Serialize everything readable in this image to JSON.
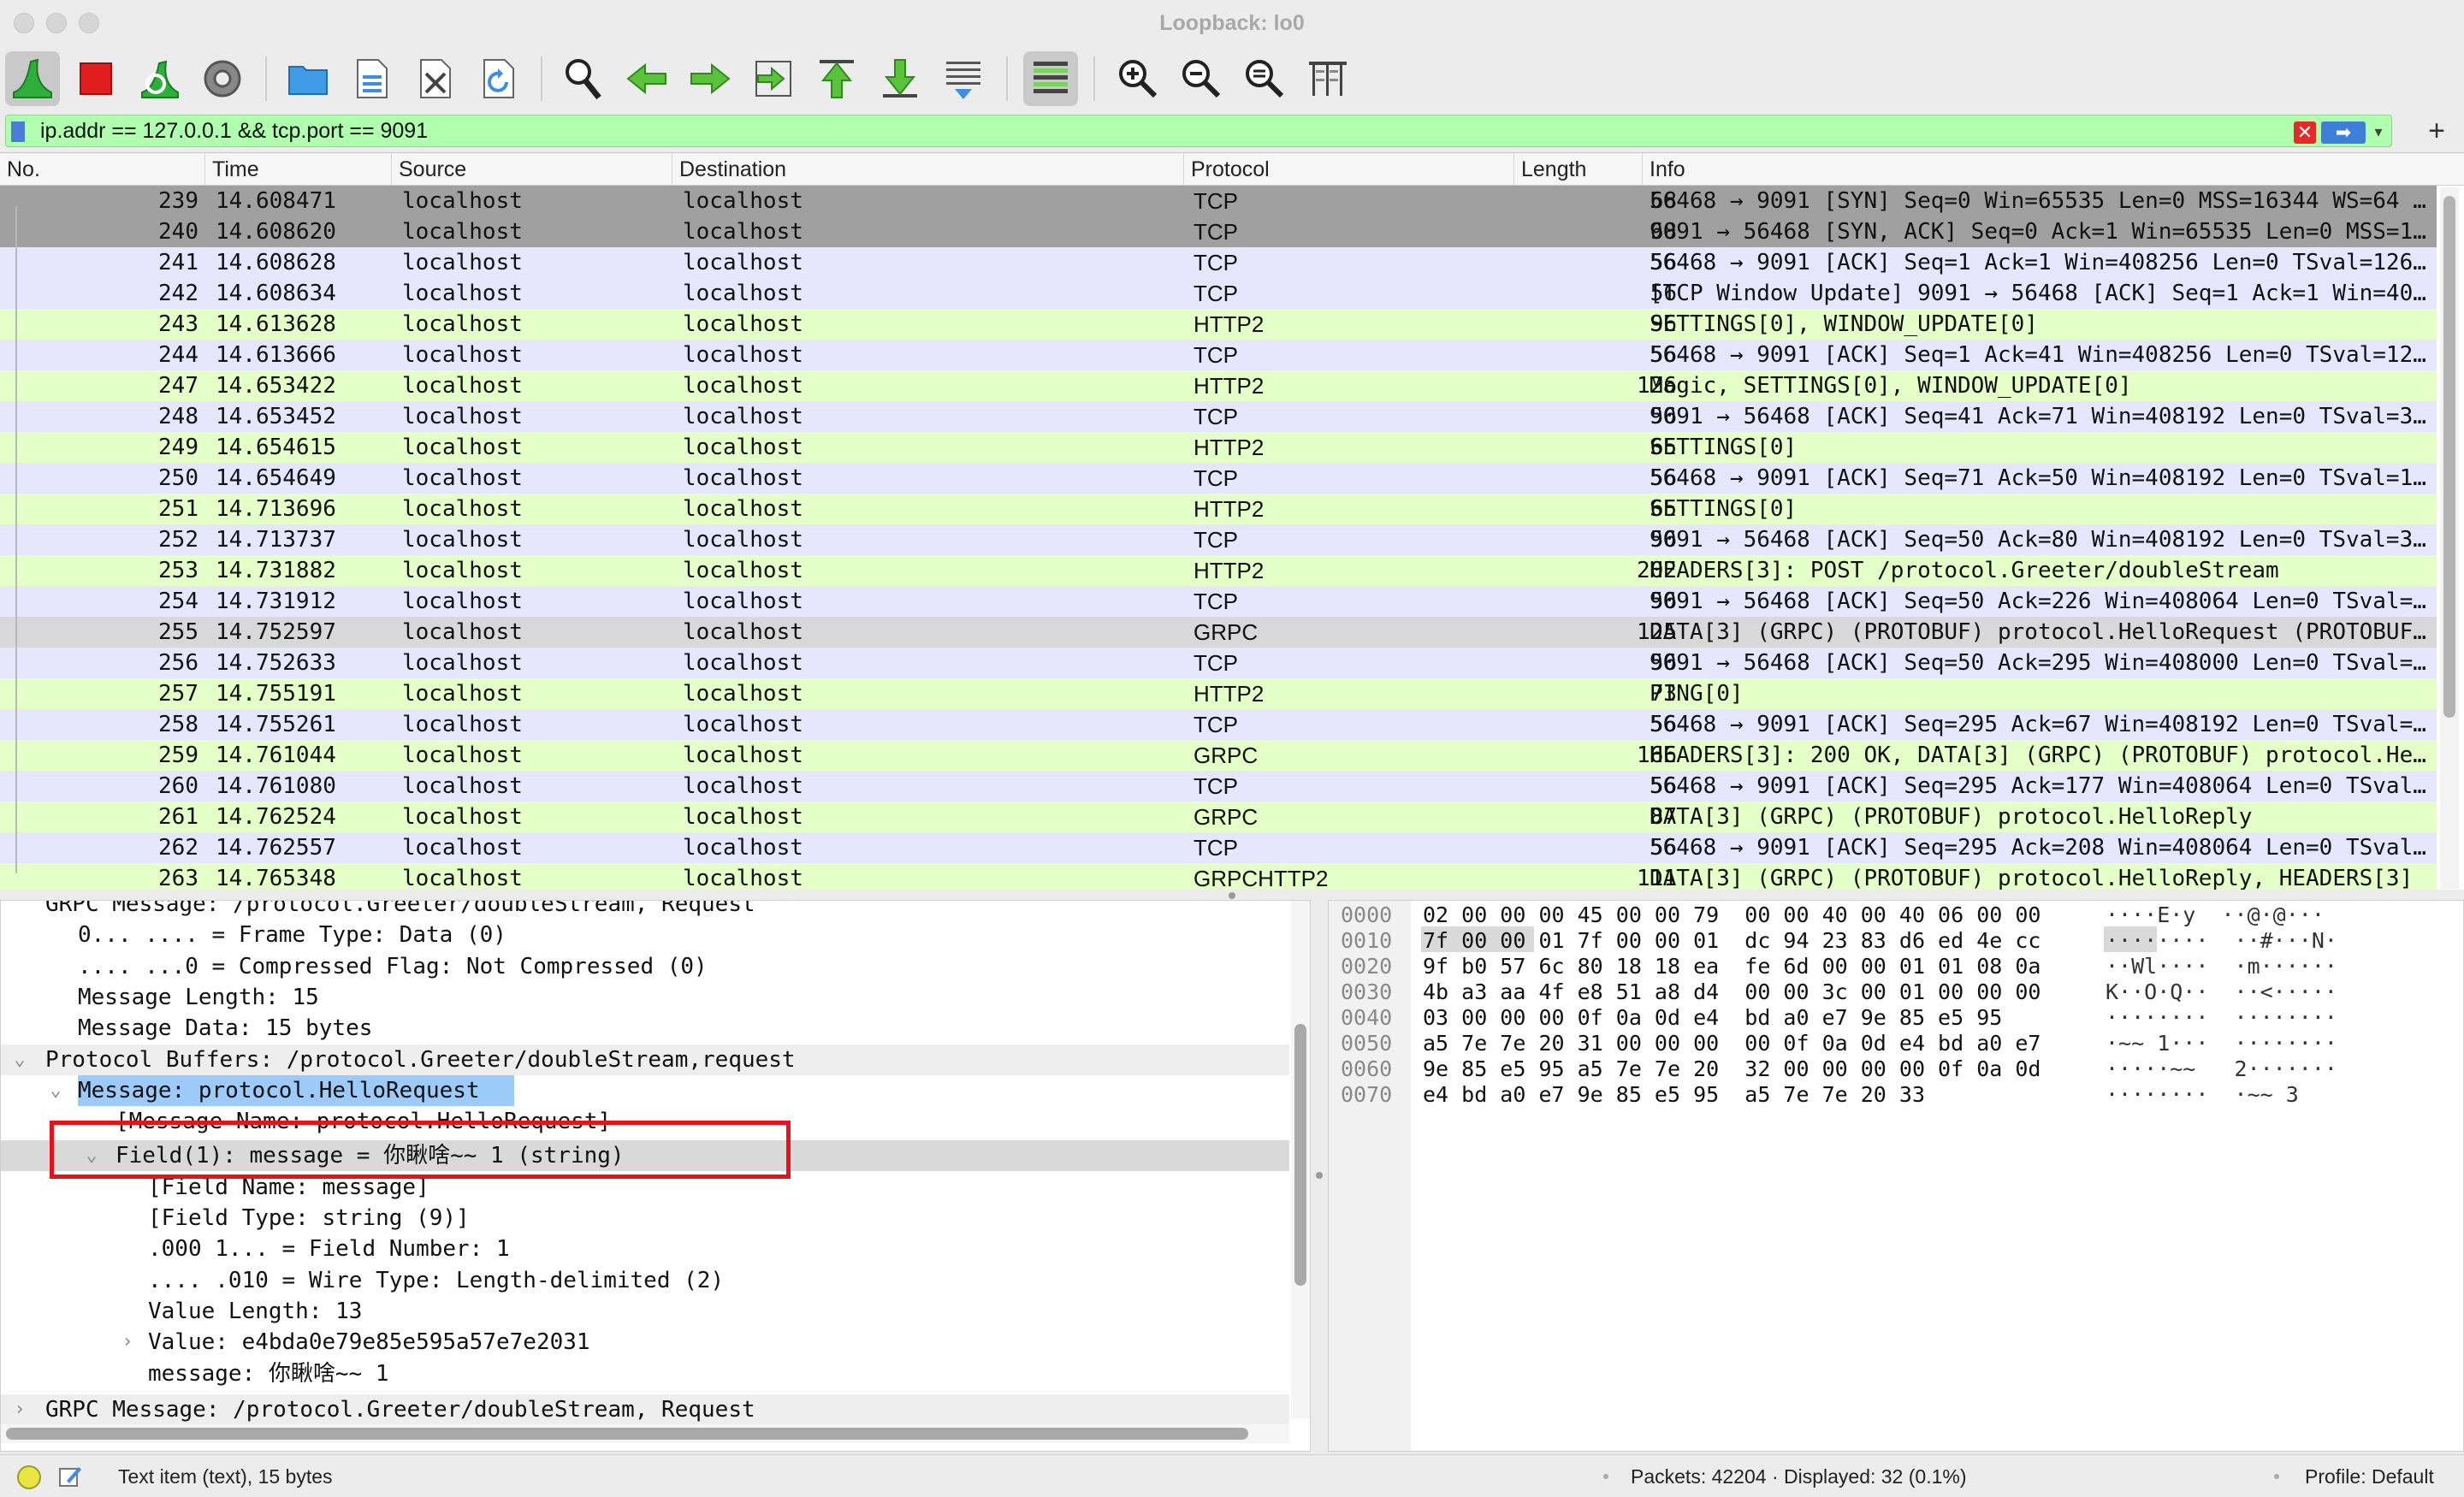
{
  "window": {
    "title": "Loopback: lo0"
  },
  "toolbar": {
    "buttons": [
      "start-capture-icon",
      "stop-capture-icon",
      "restart-capture-icon",
      "capture-options-icon",
      "open-file-icon",
      "save-file-icon",
      "close-file-icon",
      "reload-file-icon",
      "find-packet-icon",
      "go-back-icon",
      "go-forward-icon",
      "go-to-packet-icon",
      "first-packet-icon",
      "last-packet-icon",
      "autoscroll-icon",
      "colorize-icon",
      "zoom-in-icon",
      "zoom-out-icon",
      "normal-size-icon",
      "resize-columns-icon"
    ]
  },
  "filter": {
    "value": "ip.addr == 127.0.0.1  && tcp.port == 9091",
    "background": "#afffaf"
  },
  "packet_list": {
    "columns": [
      "No.",
      "Time",
      "Source",
      "Destination",
      "Protocol",
      "Length",
      "Info"
    ],
    "colors": {
      "tcp": "#e7e6ff",
      "http2": "#e4ffc7",
      "selected": "#a0a0a0",
      "related": "#d8d8d8"
    },
    "rows": [
      {
        "no": "239",
        "time": "14.608471",
        "src": "localhost",
        "dst": "localhost",
        "proto": "TCP",
        "len": "68",
        "info": "56468 → 9091 [SYN] Seq=0 Win=65535 Len=0 MSS=16344 WS=64 …",
        "style": "selected"
      },
      {
        "no": "240",
        "time": "14.608620",
        "src": "localhost",
        "dst": "localhost",
        "proto": "TCP",
        "len": "68",
        "info": "9091 → 56468 [SYN, ACK] Seq=0 Ack=1 Win=65535 Len=0 MSS=1…",
        "style": "selected"
      },
      {
        "no": "241",
        "time": "14.608628",
        "src": "localhost",
        "dst": "localhost",
        "proto": "TCP",
        "len": "56",
        "info": "56468 → 9091 [ACK] Seq=1 Ack=1 Win=408256 Len=0 TSval=126…",
        "style": "tcp"
      },
      {
        "no": "242",
        "time": "14.608634",
        "src": "localhost",
        "dst": "localhost",
        "proto": "TCP",
        "len": "56",
        "info": "[TCP Window Update] 9091 → 56468 [ACK] Seq=1 Ack=1 Win=40…",
        "style": "tcp"
      },
      {
        "no": "243",
        "time": "14.613628",
        "src": "localhost",
        "dst": "localhost",
        "proto": "HTTP2",
        "len": "96",
        "info": "SETTINGS[0], WINDOW_UPDATE[0]",
        "style": "http2"
      },
      {
        "no": "244",
        "time": "14.613666",
        "src": "localhost",
        "dst": "localhost",
        "proto": "TCP",
        "len": "56",
        "info": "56468 → 9091 [ACK] Seq=1 Ack=41 Win=408256 Len=0 TSval=12…",
        "style": "tcp"
      },
      {
        "no": "247",
        "time": "14.653422",
        "src": "localhost",
        "dst": "localhost",
        "proto": "HTTP2",
        "len": "126",
        "info": "Magic, SETTINGS[0], WINDOW_UPDATE[0]",
        "style": "http2"
      },
      {
        "no": "248",
        "time": "14.653452",
        "src": "localhost",
        "dst": "localhost",
        "proto": "TCP",
        "len": "56",
        "info": "9091 → 56468 [ACK] Seq=41 Ack=71 Win=408192 Len=0 TSval=3…",
        "style": "tcp"
      },
      {
        "no": "249",
        "time": "14.654615",
        "src": "localhost",
        "dst": "localhost",
        "proto": "HTTP2",
        "len": "65",
        "info": "SETTINGS[0]",
        "style": "http2"
      },
      {
        "no": "250",
        "time": "14.654649",
        "src": "localhost",
        "dst": "localhost",
        "proto": "TCP",
        "len": "56",
        "info": "56468 → 9091 [ACK] Seq=71 Ack=50 Win=408192 Len=0 TSval=1…",
        "style": "tcp"
      },
      {
        "no": "251",
        "time": "14.713696",
        "src": "localhost",
        "dst": "localhost",
        "proto": "HTTP2",
        "len": "65",
        "info": "SETTINGS[0]",
        "style": "http2"
      },
      {
        "no": "252",
        "time": "14.713737",
        "src": "localhost",
        "dst": "localhost",
        "proto": "TCP",
        "len": "56",
        "info": "9091 → 56468 [ACK] Seq=50 Ack=80 Win=408192 Len=0 TSval=3…",
        "style": "tcp"
      },
      {
        "no": "253",
        "time": "14.731882",
        "src": "localhost",
        "dst": "localhost",
        "proto": "HTTP2",
        "len": "202",
        "info": "HEADERS[3]: POST /protocol.Greeter/doubleStream",
        "style": "http2"
      },
      {
        "no": "254",
        "time": "14.731912",
        "src": "localhost",
        "dst": "localhost",
        "proto": "TCP",
        "len": "56",
        "info": "9091 → 56468 [ACK] Seq=50 Ack=226 Win=408064 Len=0 TSval=…",
        "style": "tcp"
      },
      {
        "no": "255",
        "time": "14.752597",
        "src": "localhost",
        "dst": "localhost",
        "proto": "GRPC",
        "len": "125",
        "info": "DATA[3] (GRPC) (PROTOBUF) protocol.HelloRequest (PROTOBUF…",
        "style": "related"
      },
      {
        "no": "256",
        "time": "14.752633",
        "src": "localhost",
        "dst": "localhost",
        "proto": "TCP",
        "len": "56",
        "info": "9091 → 56468 [ACK] Seq=50 Ack=295 Win=408000 Len=0 TSval=…",
        "style": "tcp"
      },
      {
        "no": "257",
        "time": "14.755191",
        "src": "localhost",
        "dst": "localhost",
        "proto": "HTTP2",
        "len": "73",
        "info": "PING[0]",
        "style": "http2"
      },
      {
        "no": "258",
        "time": "14.755261",
        "src": "localhost",
        "dst": "localhost",
        "proto": "TCP",
        "len": "56",
        "info": "56468 → 9091 [ACK] Seq=295 Ack=67 Win=408192 Len=0 TSval=…",
        "style": "tcp"
      },
      {
        "no": "259",
        "time": "14.761044",
        "src": "localhost",
        "dst": "localhost",
        "proto": "GRPC",
        "len": "166",
        "info": "HEADERS[3]: 200 OK, DATA[3] (GRPC) (PROTOBUF) protocol.He…",
        "style": "http2"
      },
      {
        "no": "260",
        "time": "14.761080",
        "src": "localhost",
        "dst": "localhost",
        "proto": "TCP",
        "len": "56",
        "info": "56468 → 9091 [ACK] Seq=295 Ack=177 Win=408064 Len=0 TSval…",
        "style": "tcp"
      },
      {
        "no": "261",
        "time": "14.762524",
        "src": "localhost",
        "dst": "localhost",
        "proto": "GRPC",
        "len": "87",
        "info": "DATA[3] (GRPC) (PROTOBUF) protocol.HelloReply",
        "style": "http2"
      },
      {
        "no": "262",
        "time": "14.762557",
        "src": "localhost",
        "dst": "localhost",
        "proto": "TCP",
        "len": "56",
        "info": "56468 → 9091 [ACK] Seq=295 Ack=208 Win=408064 Len=0 TSval…",
        "style": "tcp"
      },
      {
        "no": "263",
        "time": "14.765348",
        "src": "localhost",
        "dst": "localhost",
        "proto": "GRPCHTTP2",
        "len": "111",
        "info": "DATA[3] (GRPC) (PROTOBUF) protocol.HelloReply, HEADERS[3]",
        "style": "http2"
      }
    ]
  },
  "details": {
    "rows": [
      {
        "indent": 1,
        "arrow": "",
        "text": "GRPC Message: /protocol.Greeter/doubleStream, Request",
        "style": "",
        "clip": true
      },
      {
        "indent": 2,
        "arrow": "",
        "text": "0... .... = Frame Type: Data (0)",
        "style": ""
      },
      {
        "indent": 2,
        "arrow": "",
        "text": ".... ...0 = Compressed Flag: Not Compressed (0)",
        "style": ""
      },
      {
        "indent": 2,
        "arrow": "",
        "text": "Message Length: 15",
        "style": ""
      },
      {
        "indent": 2,
        "arrow": "",
        "text": "Message Data: 15 bytes",
        "style": ""
      },
      {
        "indent": 1,
        "arrow": "⌄",
        "text": "Protocol Buffers: /protocol.Greeter/doubleStream,request",
        "style": "light"
      },
      {
        "indent": 2,
        "arrow": "⌄",
        "text": "Message: protocol.HelloRequest",
        "style": "selected"
      },
      {
        "indent": 3,
        "arrow": "",
        "text": "[Message Name: protocol.HelloRequest]",
        "style": ""
      },
      {
        "indent": 3,
        "arrow": "⌄",
        "text": "Field(1): message = 你瞅啥~~ 1 (string)",
        "style": "grey"
      },
      {
        "indent": 4,
        "arrow": "",
        "text": "[Field Name: message]",
        "style": ""
      },
      {
        "indent": 4,
        "arrow": "",
        "text": "[Field Type: string (9)]",
        "style": ""
      },
      {
        "indent": 4,
        "arrow": "",
        "text": ".000 1... = Field Number: 1",
        "style": ""
      },
      {
        "indent": 4,
        "arrow": "",
        "text": ".... .010 = Wire Type: Length-delimited (2)",
        "style": ""
      },
      {
        "indent": 4,
        "arrow": "",
        "text": "Value Length: 13",
        "style": ""
      },
      {
        "indent": 4,
        "arrow": "›",
        "text": "Value: e4bda0e79e85e595a57e7e2031",
        "style": ""
      },
      {
        "indent": 4,
        "arrow": "",
        "text": "message: 你瞅啥~~ 1",
        "style": ""
      },
      {
        "indent": 1,
        "arrow": "›",
        "text": "GRPC Message: /protocol.Greeter/doubleStream, Request",
        "style": "light"
      }
    ]
  },
  "bytes": {
    "rows": [
      {
        "off": "0000",
        "hex": "02 00 00 00 45 00 00 79  00 00 40 00 40 06 00 00",
        "ascii": "····E·y  ··@·@···"
      },
      {
        "off": "0010",
        "hex": "7f 00 00 01 7f 00 00 01  dc 94 23 83 d6 ed 4e cc",
        "ascii": "········  ··#···N·"
      },
      {
        "off": "0020",
        "hex": "9f b0 57 6c 80 18 18 ea  fe 6d 00 00 01 01 08 0a",
        "ascii": "··Wl····  ·m······"
      },
      {
        "off": "0030",
        "hex": "4b a3 aa 4f e8 51 a8 d4  00 00 3c 00 01 00 00 00",
        "ascii": "K··O·Q··  ··<·····"
      },
      {
        "off": "0040",
        "hex": "03 00 00 00 0f 0a 0d e4  bd a0 e7 9e 85 e5 95",
        "ascii": "········  ········"
      },
      {
        "off": "0050",
        "hex": "a5 7e 7e 20 31 00 00 00  00 0f 0a 0d e4 bd a0 e7",
        "ascii": "·~~ 1···  ········"
      },
      {
        "off": "0060",
        "hex": "9e 85 e5 95 a5 7e 7e 20  32 00 00 00 00 0f 0a 0d",
        "ascii": "·····~~   2·······"
      },
      {
        "off": "0070",
        "hex": "e4 bd a0 e7 9e 85 e5 95  a5 7e 7e 20 33",
        "ascii": "········  ·~~ 3"
      }
    ]
  },
  "status": {
    "item": "Text item (text), 15 bytes",
    "packets": "Packets: 42204 · Displayed: 32 (0.1%)",
    "profile": "Profile: Default"
  }
}
